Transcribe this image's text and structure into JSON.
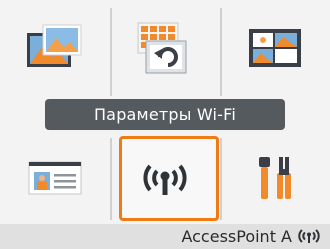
{
  "menu": {
    "top_row": [
      {
        "icon": "photo-print-icon"
      },
      {
        "icon": "layout-print-icon"
      },
      {
        "icon": "id-photo-icon"
      }
    ],
    "selected_label": "Параметры Wi-Fi",
    "bottom_row": [
      {
        "icon": "profile-card-icon"
      },
      {
        "icon": "wifi-antenna-icon"
      },
      {
        "icon": "tools-icon"
      }
    ]
  },
  "status": {
    "access_point": "AccessPoint A",
    "signal_glyph": "((i))"
  },
  "colors": {
    "accent": "#f07b14",
    "label_bg": "#555a5e",
    "status_bg": "#e0e0e0"
  }
}
